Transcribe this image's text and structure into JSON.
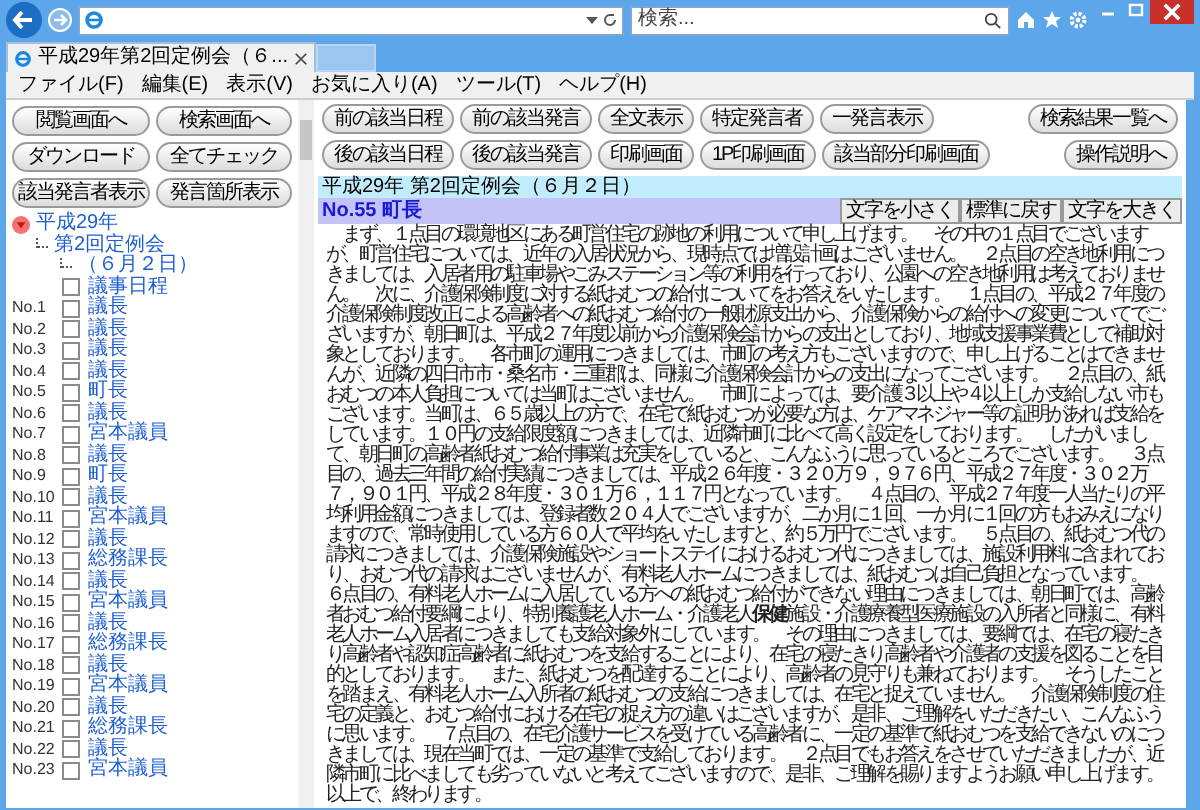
{
  "browser": {
    "search_placeholder": "検索...",
    "tab_title": "平成29年第2回定例会（６...",
    "menu": [
      "ファイル(F)",
      "編集(E)",
      "表示(V)",
      "お気に入り(A)",
      "ツール(T)",
      "ヘルプ(H)"
    ]
  },
  "sidebar": {
    "buttons": [
      "閲覧画面へ",
      "検索画面へ",
      "ダウンロード",
      "全てチェック",
      "該当発言者表示",
      "発言箇所表示"
    ],
    "tree": [
      {
        "label": "平成29年",
        "expanded": true,
        "children": [
          {
            "label": "第2回定例会",
            "children": [
              {
                "label": "（６月２日）"
              }
            ]
          }
        ]
      }
    ],
    "agenda": {
      "label": "議事日程",
      "checked": false
    },
    "speeches": [
      {
        "number": "No.1",
        "speaker": "議長",
        "checked": false
      },
      {
        "number": "No.2",
        "speaker": "議長",
        "checked": false
      },
      {
        "number": "No.3",
        "speaker": "議長",
        "checked": false
      },
      {
        "number": "No.4",
        "speaker": "議長",
        "checked": false
      },
      {
        "number": "No.5",
        "speaker": "町長",
        "checked": false
      },
      {
        "number": "No.6",
        "speaker": "議長",
        "checked": false
      },
      {
        "number": "No.7",
        "speaker": "宮本議員",
        "checked": false
      },
      {
        "number": "No.8",
        "speaker": "議長",
        "checked": false
      },
      {
        "number": "No.9",
        "speaker": "町長",
        "checked": false
      },
      {
        "number": "No.10",
        "speaker": "議長",
        "checked": false
      },
      {
        "number": "No.11",
        "speaker": "宮本議員",
        "checked": false
      },
      {
        "number": "No.12",
        "speaker": "議長",
        "checked": false
      },
      {
        "number": "No.13",
        "speaker": "総務課長",
        "checked": false
      },
      {
        "number": "No.14",
        "speaker": "議長",
        "checked": false
      },
      {
        "number": "No.15",
        "speaker": "宮本議員",
        "checked": false
      },
      {
        "number": "No.16",
        "speaker": "議長",
        "checked": false
      },
      {
        "number": "No.17",
        "speaker": "総務課長",
        "checked": false
      },
      {
        "number": "No.18",
        "speaker": "議長",
        "checked": false
      },
      {
        "number": "No.19",
        "speaker": "宮本議員",
        "checked": false
      },
      {
        "number": "No.20",
        "speaker": "議長",
        "checked": false
      },
      {
        "number": "No.21",
        "speaker": "総務課長",
        "checked": false
      },
      {
        "number": "No.22",
        "speaker": "議長",
        "checked": false
      },
      {
        "number": "No.23",
        "speaker": "宮本議員",
        "checked": false
      }
    ]
  },
  "toolbar": {
    "rows": [
      [
        "前の該当日程",
        "前の該当発言",
        "全文表示",
        "特定発言者",
        "一発言表示"
      ],
      [
        "後の該当日程",
        "後の該当発言",
        "印刷画面",
        "1P印刷画面",
        "該当部分印刷画面"
      ]
    ],
    "right_buttons": [
      "検索結果一覧へ",
      "操作説明へ"
    ]
  },
  "header": {
    "title": "平成29年 第2回定例会（６月２日）",
    "speech": "No.55 町長",
    "font_buttons": [
      "文字を小さく",
      "標準に戻す",
      "文字を大きく"
    ]
  },
  "paragraphs": [
    "まず、１点目の環境地区にある町営住宅の跡地の利用について申し上げます。",
    "その中の１点目でございますが、町営住宅については、近年の入居状況から、現時点では増設計画はございません。",
    "２点目の空き地利用につきましては、入居者用の駐車場やごみステーション等の利用を行っており、公園への空き地利用は考えておりません。",
    "次に、介護保険制度に対する紙おむつの給付についてをお答えをいたします。",
    "１点目の、平成２７年度の介護保険制度改正による高齢者への紙おむつ給付の一般財源支出から、介護保険からの給付への変更についてでございますが、朝日町は、平成２７年度以前から介護保険会計からの支出としており、地域支援事業費として補助対象としております。",
    "各市町の運用につきましては、市町の考え方もございますので、申し上げることはできませんが、近隣の四日市市・桑名市・三重郡は、同様に介護保険会計からの支出になってございます。",
    "２点目の、紙おむつの本人負担については当町はございません。",
    "市町によっては、要介護３以上や４以上しか支給しない市もございます。当町は、６５歳以上の方で、在宅で紙おむつが必要な方は、ケアマネジャー等の証明があれば支給をしています。１０円の支給限度額につきましては、近隣市町に比べて高く設定をしております。",
    "したがいまして、朝日町の高齢者紙おむつ給付事業は充実をしていると、こんなふうに思っているところでございます。",
    "３点目の、過去三年間の給付実績につきましては、平成２６年度・３２０万９，９７６円、平成２７年度・３０２万７，９０１円、平成２８年度・３０１万６，１１７円となっています。",
    "４点目の、平成２７年度一人当たりの平均利用金額につきましては、登録者数２０４人でございますが、二か月に１回、一か月に１回の方もおみえになりますので、常時使用している方６０人で平均をいたしますと、約５万円でございます。",
    "５点目の、紙おむつ代の請求につきましては、介護保険施設やショートステイにおけるおむつ代につきましては、施設利用料に含まれており、おむつ代の請求はございませんが、有料老人ホームにつきましては、紙おむつは自己負担となっています。",
    "６点目の、有料老人ホームに入居している方への紙おむつ給付ができない理由につきましては、朝日町では、高齢者おむつ給付要綱により、特別養護老人ホーム・介護老人**保健**施設・介護療養型医療施設の入所者と同様に、有料老人ホーム入居者につきましても支給対象外にしています。",
    "その理由につきましては、要綱では、在宅の寝たきり高齢者や認知症高齢者に紙おむつを支給することにより、在宅の寝たきり高齢者や介護者の支援を図ることを目的としております。",
    "また、紙おむつを配達することにより、高齢者の見守りも兼ねております。",
    "そうしたことを踏まえ、有料老人ホーム入所者の紙おむつの支給につきましては、在宅と捉えていません。",
    "介護保険制度の住宅の定義と、おむつ給付における在宅の捉え方の違いはございますが、是非、ご理解をいただきたい、こんなふうに思います。",
    "７点目の、在宅介護サービスを受けている高齢者に、一定の基準で紙おむつを支給できないのにつきましては、現在当町では、一定の基準で支給しております。",
    "２点目でもお答えをさせていただきましたが、近隣市町に比べましても劣っていないと考えてございますので、是非、ご理解を賜りますようお願い申し上げます。",
    "以上で、終わります。"
  ]
}
